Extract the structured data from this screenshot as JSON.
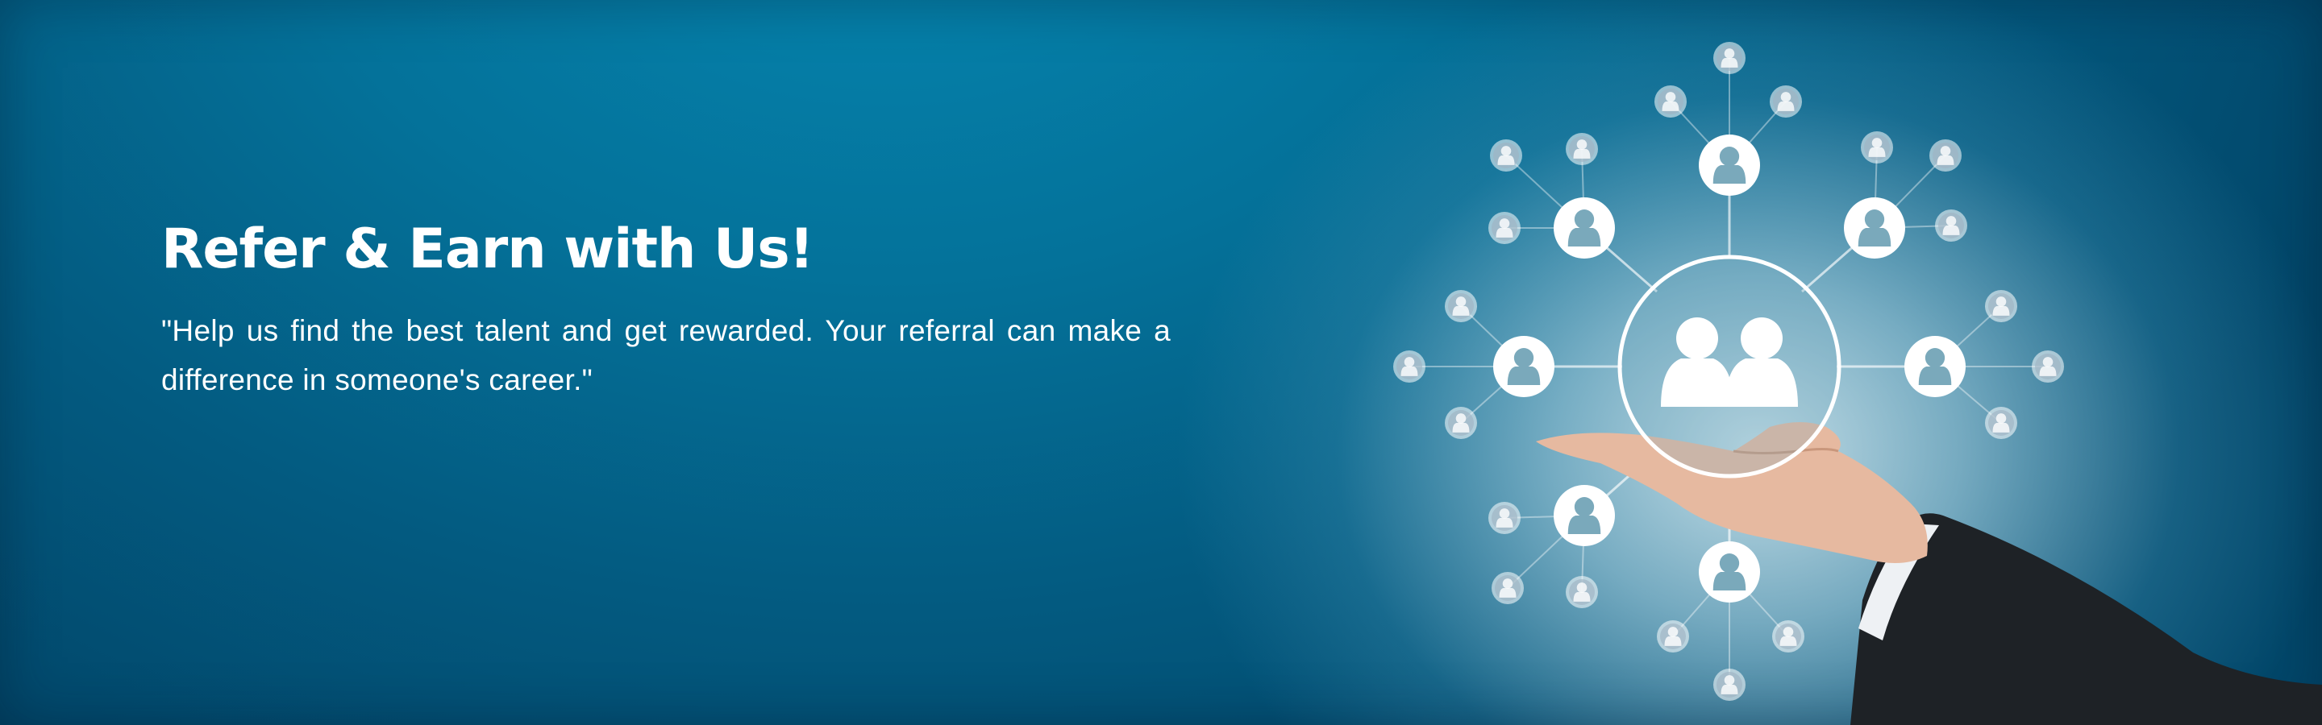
{
  "banner": {
    "title": "Refer & Earn with Us!",
    "subtitle": "\"Help us find the best talent and get rewarded. Your referral can make a difference in someone's career.\""
  },
  "theme": {
    "background_dark": "#035a80",
    "background_light": "#0686b0",
    "glow": "#cde4ec",
    "text": "#ffffff"
  },
  "illustration": {
    "center_icon": "group-people-icon",
    "node_icon": "person-icon",
    "hand": "open-palm-hand"
  }
}
